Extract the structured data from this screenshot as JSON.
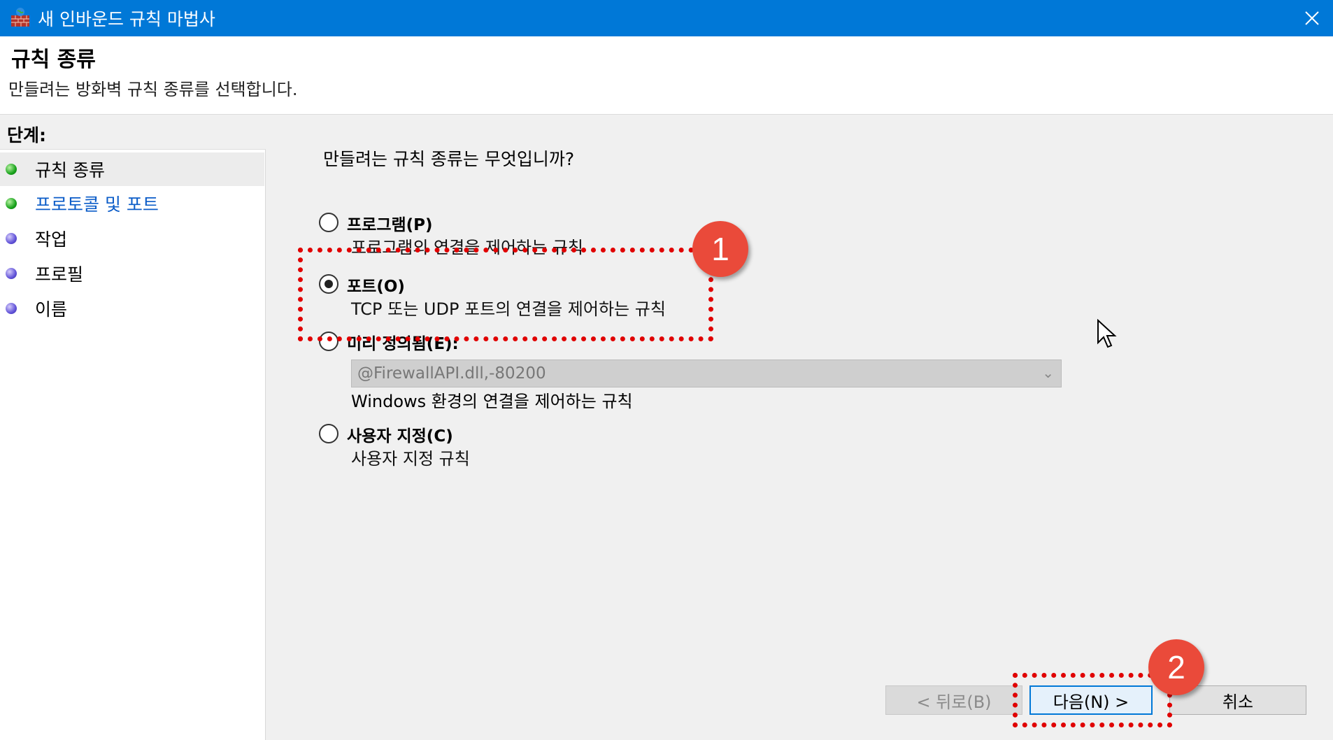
{
  "window": {
    "title": "새 인바운드 규칙 마법사",
    "close_icon": "close-icon"
  },
  "header": {
    "title": "규칙 종류",
    "subtitle": "만들려는 방화벽 규칙 종류를 선택합니다."
  },
  "steps": {
    "heading": "단계:",
    "items": [
      {
        "label": "규칙 종류",
        "status": "green",
        "active": true
      },
      {
        "label": "프로토콜 및 포트",
        "status": "green",
        "link": true
      },
      {
        "label": "작업",
        "status": "blue"
      },
      {
        "label": "프로필",
        "status": "blue"
      },
      {
        "label": "이름",
        "status": "blue"
      }
    ]
  },
  "main": {
    "question": "만들려는 규칙 종류는 무엇입니까?",
    "options": [
      {
        "label": "프로그램(P)",
        "desc": "프로그램의 연결을 제어하는 규칙",
        "checked": false
      },
      {
        "label": "포트(O)",
        "desc": "TCP 또는 UDP 포트의 연결을 제어하는 규칙",
        "checked": true
      },
      {
        "label": "미리 정의됨(E):",
        "desc": "Windows 환경의 연결을 제어하는 규칙",
        "checked": false,
        "select_value": "@FirewallAPI.dll,-80200"
      },
      {
        "label": "사용자 지정(C)",
        "desc": "사용자 지정 규칙",
        "checked": false
      }
    ]
  },
  "buttons": {
    "back": "< 뒤로(B)",
    "next": "다음(N) >",
    "cancel": "취소"
  },
  "annotations": {
    "badge1": "1",
    "badge2": "2",
    "color": "#e00000"
  }
}
